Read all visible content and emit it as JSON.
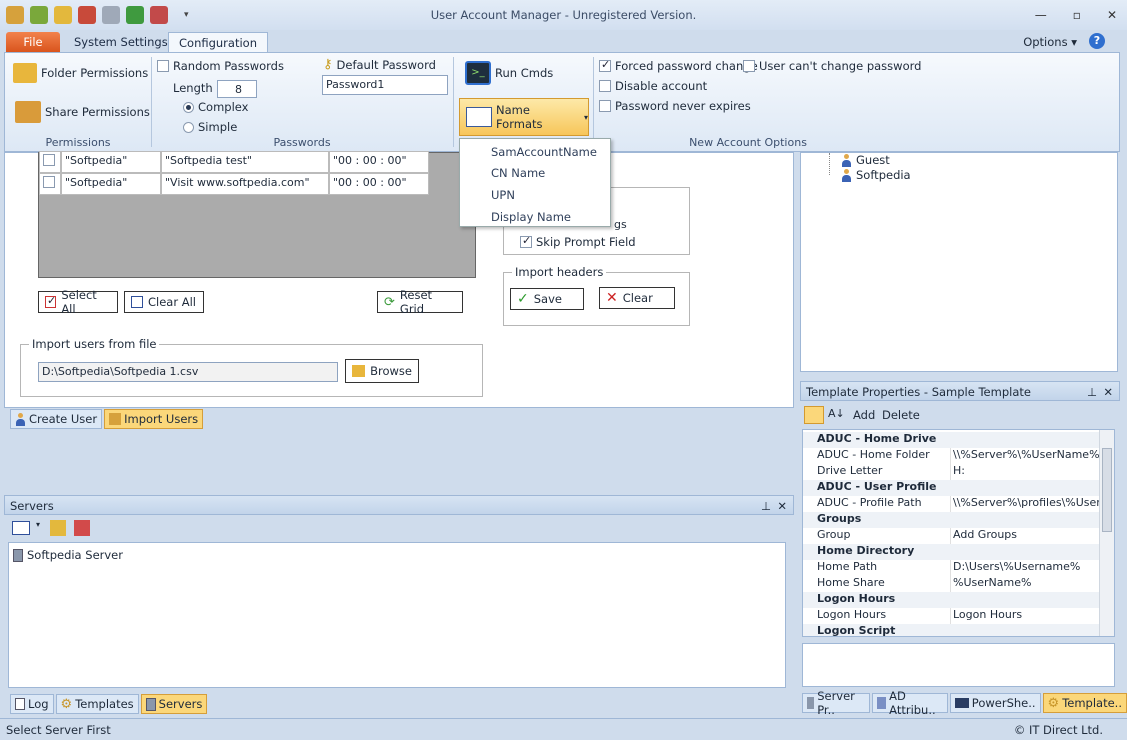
{
  "window": {
    "title": "User Account Manager - Unregistered Version."
  },
  "tabs": {
    "file": "File",
    "system": "System Settings",
    "config": "Configuration"
  },
  "header": {
    "options": "Options",
    "help": "?"
  },
  "ribbon": {
    "permissions": {
      "folder": "Folder Permissions",
      "share": "Share Permissions",
      "label": "Permissions"
    },
    "passwords": {
      "random": "Random Passwords",
      "length_label": "Length",
      "length_value": "8",
      "complex": "Complex",
      "simple": "Simple",
      "default_label": "Default Password",
      "default_value": "Password1",
      "label": "Passwords"
    },
    "run_cmds": "Run Cmds",
    "name_formats": "Name Formats",
    "account_options": {
      "forced": "Forced password change",
      "cant_change": "User can't change password",
      "disable": "Disable account",
      "never_expires": "Password never expires",
      "label": "New Account Options"
    }
  },
  "dropdown": [
    "SamAccountName",
    "CN Name",
    "UPN",
    "Display Name"
  ],
  "grid": {
    "rows": [
      [
        "\"Softpedia\"",
        "\"Softpedia test\"",
        "\"00 : 00 : 00\""
      ],
      [
        "\"Softpedia\"",
        "\"Visit www.softpedia.com\"",
        "\"00 : 00 : 00\""
      ]
    ]
  },
  "grid_buttons": {
    "select_all": "Select All",
    "clear_all": "Clear All",
    "reset_grid": "Reset Grid"
  },
  "settings_box": {
    "partial": "gs",
    "skip_prompt": "Skip Prompt Field"
  },
  "import_headers": {
    "legend": "Import headers",
    "save": "Save",
    "clear": "Clear"
  },
  "import_file": {
    "legend": "Import users from file",
    "path": "D:\\Softpedia\\Softpedia 1.csv",
    "browse": "Browse"
  },
  "main_tabs": {
    "create": "Create User",
    "import": "Import Users"
  },
  "servers": {
    "title": "Servers",
    "items": [
      "Softpedia Server"
    ]
  },
  "left_bottom_tabs": {
    "log": "Log",
    "templates": "Templates",
    "servers": "Servers"
  },
  "tree": [
    "Guest",
    "Softpedia"
  ],
  "template_props": {
    "title": "Template Properties - Sample Template",
    "add": "Add",
    "delete": "Delete",
    "rows": [
      {
        "type": "cat",
        "name": "ADUC - Home Drive"
      },
      {
        "type": "prop",
        "name": "ADUC - Home Folder",
        "value": "\\\\%Server%\\%UserName%"
      },
      {
        "type": "prop",
        "name": "Drive Letter",
        "value": "H:"
      },
      {
        "type": "cat",
        "name": "ADUC - User Profile"
      },
      {
        "type": "prop",
        "name": "ADUC - Profile Path",
        "value": "\\\\%Server%\\profiles\\%User"
      },
      {
        "type": "cat",
        "name": "Groups"
      },
      {
        "type": "prop",
        "name": "Group",
        "value": "Add Groups"
      },
      {
        "type": "cat",
        "name": "Home Directory"
      },
      {
        "type": "prop",
        "name": "Home Path",
        "value": "D:\\Users\\%Username%"
      },
      {
        "type": "prop",
        "name": "Home Share",
        "value": "%UserName%"
      },
      {
        "type": "cat",
        "name": "Logon Hours"
      },
      {
        "type": "prop",
        "name": "Logon Hours",
        "value": "Logon Hours"
      },
      {
        "type": "cat",
        "name": "Logon Script"
      }
    ]
  },
  "right_bottom_tabs": {
    "server": "Server Pr..",
    "ad": "AD Attribu..",
    "ps": "PowerShe..",
    "templates": "Template.."
  },
  "status": {
    "left": "Select Server First",
    "right": "© IT Direct Ltd."
  },
  "colors": {
    "file_tab": "#e06a2c",
    "active_tab": "#fbd77a",
    "accent": "#2f6fcf"
  }
}
